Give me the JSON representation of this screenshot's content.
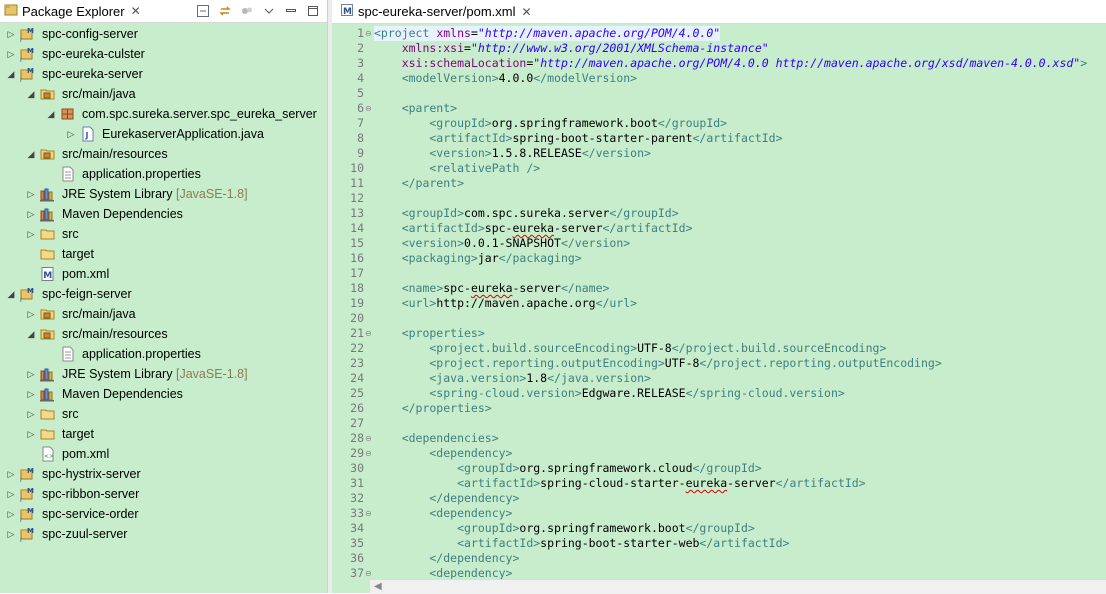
{
  "package_explorer": {
    "title": "Package Explorer",
    "close": "✕",
    "tree": [
      {
        "label": "spc-config-server",
        "depth": 0,
        "twisty": "closed",
        "icon": "maven-project-icon"
      },
      {
        "label": "spc-eureka-culster",
        "depth": 0,
        "twisty": "closed",
        "icon": "maven-project-icon"
      },
      {
        "label": "spc-eureka-server",
        "depth": 0,
        "twisty": "open",
        "icon": "maven-project-icon"
      },
      {
        "label": "src/main/java",
        "depth": 1,
        "twisty": "open",
        "icon": "source-folder-icon"
      },
      {
        "label": "com.spc.sureka.server.spc_eureka_server",
        "depth": 2,
        "twisty": "open",
        "icon": "package-icon"
      },
      {
        "label": "EurekaserverApplication.java",
        "depth": 3,
        "twisty": "closed",
        "icon": "java-file-icon"
      },
      {
        "label": "src/main/resources",
        "depth": 1,
        "twisty": "open",
        "icon": "source-folder-icon"
      },
      {
        "label": "application.properties",
        "depth": 2,
        "twisty": "none",
        "icon": "properties-file-icon"
      },
      {
        "label": "JRE System Library",
        "decoration": "[JavaSE-1.8]",
        "depth": 1,
        "twisty": "closed",
        "icon": "library-icon"
      },
      {
        "label": "Maven Dependencies",
        "depth": 1,
        "twisty": "closed",
        "icon": "library-icon"
      },
      {
        "label": "src",
        "depth": 1,
        "twisty": "closed",
        "icon": "folder-icon"
      },
      {
        "label": "target",
        "depth": 1,
        "twisty": "none",
        "icon": "folder-icon"
      },
      {
        "label": "pom.xml",
        "depth": 1,
        "twisty": "none",
        "icon": "maven-file-icon"
      },
      {
        "label": "spc-feign-server",
        "depth": 0,
        "twisty": "open",
        "icon": "maven-project-icon"
      },
      {
        "label": "src/main/java",
        "depth": 1,
        "twisty": "closed",
        "icon": "source-folder-icon"
      },
      {
        "label": "src/main/resources",
        "depth": 1,
        "twisty": "open",
        "icon": "source-folder-icon"
      },
      {
        "label": "application.properties",
        "depth": 2,
        "twisty": "none",
        "icon": "properties-file-icon"
      },
      {
        "label": "JRE System Library",
        "decoration": "[JavaSE-1.8]",
        "depth": 1,
        "twisty": "closed",
        "icon": "library-icon"
      },
      {
        "label": "Maven Dependencies",
        "depth": 1,
        "twisty": "closed",
        "icon": "library-icon"
      },
      {
        "label": "src",
        "depth": 1,
        "twisty": "closed",
        "icon": "folder-icon"
      },
      {
        "label": "target",
        "depth": 1,
        "twisty": "closed",
        "icon": "folder-icon"
      },
      {
        "label": "pom.xml",
        "depth": 1,
        "twisty": "none",
        "icon": "xml-file-icon"
      },
      {
        "label": "spc-hystrix-server",
        "depth": 0,
        "twisty": "closed",
        "icon": "maven-project-icon"
      },
      {
        "label": "spc-ribbon-server",
        "depth": 0,
        "twisty": "closed",
        "icon": "maven-project-icon"
      },
      {
        "label": "spc-service-order",
        "depth": 0,
        "twisty": "closed",
        "icon": "maven-project-icon"
      },
      {
        "label": "spc-zuul-server",
        "depth": 0,
        "twisty": "closed",
        "icon": "maven-project-icon"
      }
    ]
  },
  "editor": {
    "tab_title": "spc-eureka-server/pom.xml",
    "close": "✕",
    "lines": [
      {
        "n": "1",
        "fold": "⊖",
        "tokens": [
          [
            "t",
            "<project "
          ],
          [
            "a",
            "xmlns"
          ],
          [
            "p",
            "="
          ],
          [
            "s",
            "\"http://maven.apache.org/POM/4.0.0\""
          ]
        ]
      },
      {
        "n": "2",
        "tokens": [
          [
            "p",
            "    "
          ],
          [
            "a",
            "xmlns:xsi"
          ],
          [
            "p",
            "="
          ],
          [
            "s",
            "\"http://www.w3.org/2001/XMLSchema-instance\""
          ]
        ]
      },
      {
        "n": "3",
        "tokens": [
          [
            "p",
            "    "
          ],
          [
            "a",
            "xsi:schemaLocation"
          ],
          [
            "p",
            "="
          ],
          [
            "s",
            "\"http://maven.apache.org/POM/4.0.0 http://maven.apache.org/xsd/maven-4.0.0.xsd\""
          ],
          [
            "t",
            ">"
          ]
        ]
      },
      {
        "n": "4",
        "tokens": [
          [
            "t",
            "    <modelVersion>"
          ],
          [
            "p",
            "4.0.0"
          ],
          [
            "t",
            "</modelVersion>"
          ]
        ]
      },
      {
        "n": "5",
        "tokens": []
      },
      {
        "n": "6",
        "fold": "⊖",
        "tokens": [
          [
            "t",
            "    <parent>"
          ]
        ]
      },
      {
        "n": "7",
        "tokens": [
          [
            "t",
            "        <groupId>"
          ],
          [
            "p",
            "org.springframework.boot"
          ],
          [
            "t",
            "</groupId>"
          ]
        ]
      },
      {
        "n": "8",
        "tokens": [
          [
            "t",
            "        <artifactId>"
          ],
          [
            "p",
            "spring-boot-starter-parent"
          ],
          [
            "t",
            "</artifactId>"
          ]
        ]
      },
      {
        "n": "9",
        "tokens": [
          [
            "t",
            "        <version>"
          ],
          [
            "p",
            "1.5.8.RELEASE"
          ],
          [
            "t",
            "</version>"
          ]
        ]
      },
      {
        "n": "10",
        "tokens": [
          [
            "t",
            "        <relativePath />"
          ]
        ]
      },
      {
        "n": "11",
        "tokens": [
          [
            "t",
            "    </parent>"
          ]
        ]
      },
      {
        "n": "12",
        "tokens": []
      },
      {
        "n": "13",
        "tokens": [
          [
            "t",
            "    <groupId>"
          ],
          [
            "p",
            "com.spc.sureka.server"
          ],
          [
            "t",
            "</groupId>"
          ]
        ]
      },
      {
        "n": "14",
        "tokens": [
          [
            "t",
            "    <artifactId>"
          ],
          [
            "p",
            "spc-"
          ],
          [
            "q",
            "eureka"
          ],
          [
            "p",
            "-server"
          ],
          [
            "t",
            "</artifactId>"
          ]
        ]
      },
      {
        "n": "15",
        "tokens": [
          [
            "t",
            "    <version>"
          ],
          [
            "p",
            "0.0.1-SNAPSHOT"
          ],
          [
            "t",
            "</version>"
          ]
        ]
      },
      {
        "n": "16",
        "tokens": [
          [
            "t",
            "    <packaging>"
          ],
          [
            "p",
            "jar"
          ],
          [
            "t",
            "</packaging>"
          ]
        ]
      },
      {
        "n": "17",
        "tokens": []
      },
      {
        "n": "18",
        "tokens": [
          [
            "t",
            "    <name>"
          ],
          [
            "p",
            "spc-"
          ],
          [
            "q",
            "eureka"
          ],
          [
            "p",
            "-server"
          ],
          [
            "t",
            "</name>"
          ]
        ]
      },
      {
        "n": "19",
        "tokens": [
          [
            "t",
            "    <url>"
          ],
          [
            "p",
            "http://maven.apache.org"
          ],
          [
            "t",
            "</url>"
          ]
        ]
      },
      {
        "n": "20",
        "tokens": []
      },
      {
        "n": "21",
        "fold": "⊖",
        "tokens": [
          [
            "t",
            "    <properties>"
          ]
        ]
      },
      {
        "n": "22",
        "tokens": [
          [
            "t",
            "        <project.build.sourceEncoding>"
          ],
          [
            "p",
            "UTF-8"
          ],
          [
            "t",
            "</project.build.sourceEncoding>"
          ]
        ]
      },
      {
        "n": "23",
        "tokens": [
          [
            "t",
            "        <project.reporting.outputEncoding>"
          ],
          [
            "p",
            "UTF-8"
          ],
          [
            "t",
            "</project.reporting.outputEncoding>"
          ]
        ]
      },
      {
        "n": "24",
        "tokens": [
          [
            "t",
            "        <java.version>"
          ],
          [
            "p",
            "1.8"
          ],
          [
            "t",
            "</java.version>"
          ]
        ]
      },
      {
        "n": "25",
        "tokens": [
          [
            "t",
            "        <spring-cloud.version>"
          ],
          [
            "p",
            "Edgware.RELEASE"
          ],
          [
            "t",
            "</spring-cloud.version>"
          ]
        ]
      },
      {
        "n": "26",
        "tokens": [
          [
            "t",
            "    </properties>"
          ]
        ]
      },
      {
        "n": "27",
        "tokens": []
      },
      {
        "n": "28",
        "fold": "⊖",
        "tokens": [
          [
            "t",
            "    <dependencies>"
          ]
        ]
      },
      {
        "n": "29",
        "fold": "⊖",
        "tokens": [
          [
            "t",
            "        <dependency>"
          ]
        ]
      },
      {
        "n": "30",
        "tokens": [
          [
            "t",
            "            <groupId>"
          ],
          [
            "p",
            "org.springframework.cloud"
          ],
          [
            "t",
            "</groupId>"
          ]
        ]
      },
      {
        "n": "31",
        "tokens": [
          [
            "t",
            "            <artifactId>"
          ],
          [
            "p",
            "spring-cloud-starter-"
          ],
          [
            "q",
            "eureka"
          ],
          [
            "p",
            "-server"
          ],
          [
            "t",
            "</artifactId>"
          ]
        ]
      },
      {
        "n": "32",
        "tokens": [
          [
            "t",
            "        </dependency>"
          ]
        ]
      },
      {
        "n": "33",
        "fold": "⊖",
        "tokens": [
          [
            "t",
            "        <dependency>"
          ]
        ]
      },
      {
        "n": "34",
        "tokens": [
          [
            "t",
            "            <groupId>"
          ],
          [
            "p",
            "org.springframework.boot"
          ],
          [
            "t",
            "</groupId>"
          ]
        ]
      },
      {
        "n": "35",
        "tokens": [
          [
            "t",
            "            <artifactId>"
          ],
          [
            "p",
            "spring-boot-starter-web"
          ],
          [
            "t",
            "</artifactId>"
          ]
        ]
      },
      {
        "n": "36",
        "tokens": [
          [
            "t",
            "        </dependency>"
          ]
        ]
      },
      {
        "n": "37",
        "fold": "⊖",
        "tokens": [
          [
            "t",
            "        <dependency>"
          ]
        ]
      }
    ]
  }
}
